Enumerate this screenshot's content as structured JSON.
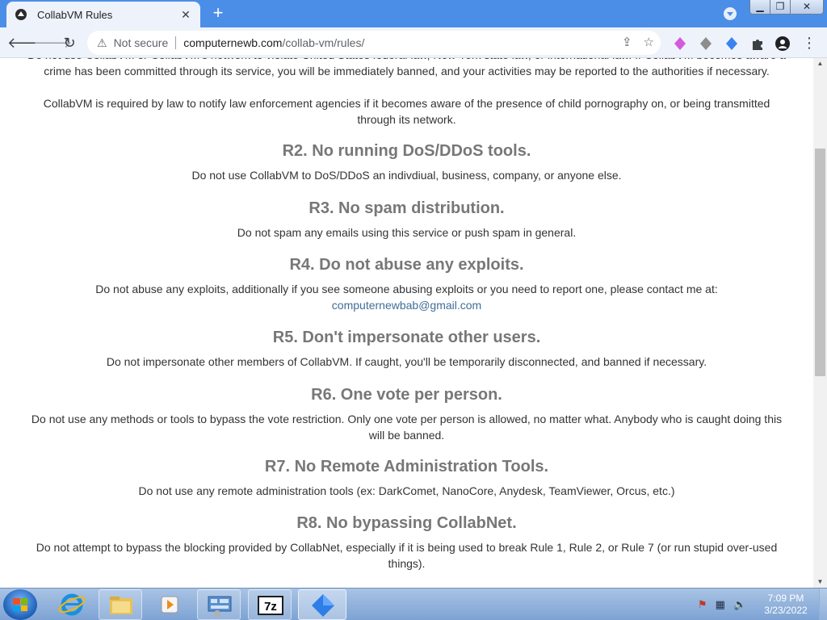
{
  "browser": {
    "tab_title": "CollabVM Rules",
    "tab_close": "✕",
    "new_tab": "+",
    "security_label": "Not secure",
    "url_host": "computernewb.com",
    "url_path": "/collab-vm/rules/"
  },
  "rules_page": {
    "intro_partial": "Do not use CollabVM or CollabVM's network to violate United States federal law, New York state law, or international law. If CollabVM becomes aware a crime has been committed through its service, you will be immediately banned, and your activities may be reported to the authorities if necessary.",
    "law_notice": "CollabVM is required by law to notify law enforcement agencies if it becomes aware of the presence of child pornography on, or being transmitted through its network.",
    "rules": [
      {
        "title": "R2. No running DoS/DDoS tools.",
        "body": "Do not use CollabVM to DoS/DDoS an indivdiual, business, company, or anyone else."
      },
      {
        "title": "R3. No spam distribution.",
        "body": "Do not spam any emails using this service or push spam in general."
      },
      {
        "title": "R4. Do not abuse any exploits.",
        "body": "Do not abuse any exploits, additionally if you see someone abusing exploits or you need to report one, please contact me at:",
        "contact": "computernewbab@gmail.com"
      },
      {
        "title": "R5. Don't impersonate other users.",
        "body": "Do not impersonate other members of CollabVM. If caught, you'll be temporarily disconnected, and banned if necessary."
      },
      {
        "title": "R6. One vote per person.",
        "body": "Do not use any methods or tools to bypass the vote restriction. Only one vote per person is allowed, no matter what. Anybody who is caught doing this will be banned."
      },
      {
        "title": "R7. No Remote Administration Tools.",
        "body": "Do not use any remote administration tools (ex: DarkComet, NanoCore, Anydesk, TeamViewer, Orcus, etc.)"
      },
      {
        "title": "R8. No bypassing CollabNet.",
        "body": "Do not attempt to bypass the blocking provided by CollabNet, especially if it is being used to break Rule 1, Rule 2, or Rule 7 (or run stupid over-used things)."
      }
    ]
  },
  "taskbar": {
    "time": "7:09 PM",
    "date": "3/23/2022"
  },
  "colors": {
    "tabstrip": "#4b8ee8",
    "heading": "#777777",
    "link": "#3f6e98"
  }
}
